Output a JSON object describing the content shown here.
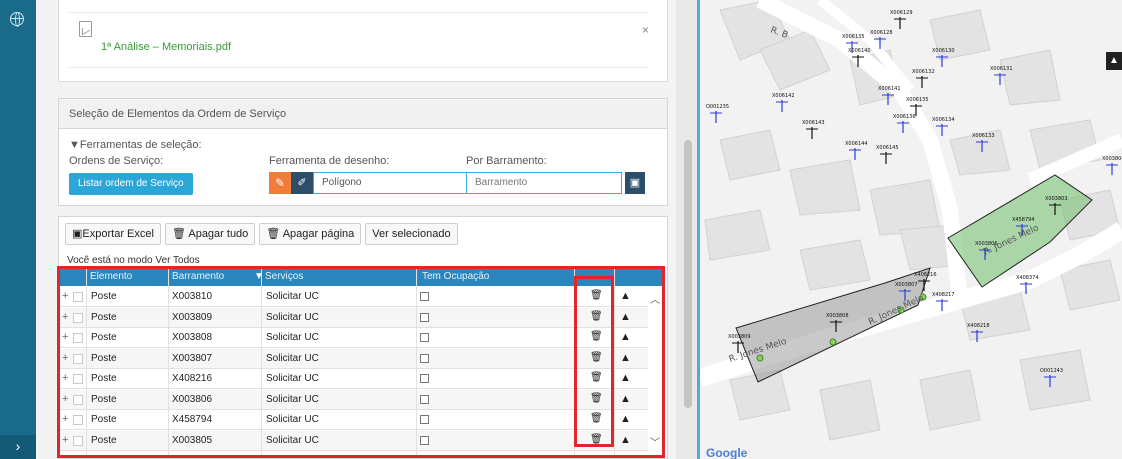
{
  "attachment": {
    "file_name": "1ª Análise – Memoriais.pdf",
    "close": "×"
  },
  "selection": {
    "header": "Seleção de Elementos da Ordem de Serviço",
    "tools_title": "Ferramentas de seleção:",
    "orders_label": "Ordens de Serviço:",
    "draw_label": "Ferramenta de desenho:",
    "bus_label": "Por Barramento:",
    "list_orders_btn": "Listar ordem de Serviço",
    "polygon_value": "Polígono",
    "bus_placeholder": "Barramento"
  },
  "toolbar": {
    "export": "Exportar Excel",
    "delete_all": "Apagar tudo",
    "delete_page": "Apagar página",
    "view_selected": "Ver selecionado"
  },
  "mode_text": "Você está no modo Ver Todos",
  "grid": {
    "headers": [
      "Elemento",
      "Barramento",
      "Serviços",
      "Tem Ocupação"
    ],
    "rows": [
      {
        "elemento": "Poste",
        "barramento": "X003810",
        "servico": "Solicitar UC"
      },
      {
        "elemento": "Poste",
        "barramento": "X003809",
        "servico": "Solicitar UC"
      },
      {
        "elemento": "Poste",
        "barramento": "X003808",
        "servico": "Solicitar UC"
      },
      {
        "elemento": "Poste",
        "barramento": "X003807",
        "servico": "Solicitar UC"
      },
      {
        "elemento": "Poste",
        "barramento": "X408216",
        "servico": "Solicitar UC"
      },
      {
        "elemento": "Poste",
        "barramento": "X003806",
        "servico": "Solicitar UC"
      },
      {
        "elemento": "Poste",
        "barramento": "X458794",
        "servico": "Solicitar UC"
      },
      {
        "elemento": "Poste",
        "barramento": "X003805",
        "servico": "Solicitar UC"
      }
    ]
  },
  "map": {
    "attribution": "Google",
    "streets": [
      "R. B",
      "R. Jones Melo",
      "R. Jones Melo",
      "R. Jones Melo"
    ],
    "labels": [
      "X006129",
      "X006135",
      "X006128",
      "X006140",
      "X006130",
      "X006131",
      "X006132",
      "X006141",
      "X006142",
      "X006135",
      "X006136",
      "X006134",
      "X006143",
      "X006133",
      "X006144",
      "X006145",
      "O001235",
      "X003804",
      "X003803",
      "X458794",
      "X003806",
      "X408216",
      "X003807",
      "X408217",
      "X003808",
      "X408374",
      "X408218",
      "X003809",
      "O001243"
    ]
  }
}
